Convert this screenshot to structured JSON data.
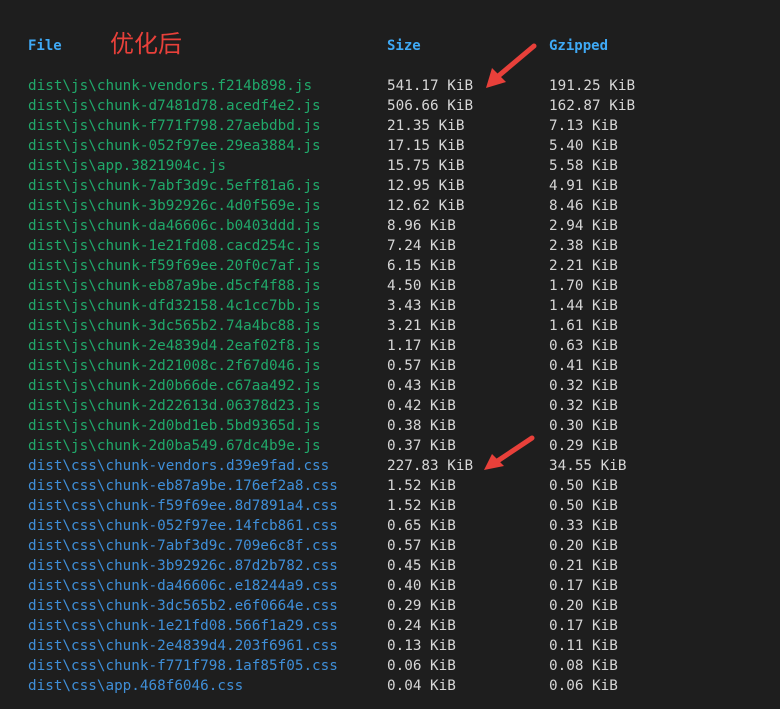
{
  "header": {
    "file": "File",
    "size": "Size",
    "gzipped": "Gzipped"
  },
  "annotation": "优化后",
  "colors": {
    "background": "#1e1e1e",
    "js": "#20a86a",
    "css": "#3f8fd8",
    "header": "#3fa9f5",
    "annotation": "#e8403a",
    "value": "#d6d6d6"
  },
  "rows": [
    {
      "file": "dist\\js\\chunk-vendors.f214b898.js",
      "size": "541.17 KiB",
      "gzip": "191.25 KiB",
      "kind": "js"
    },
    {
      "file": "dist\\js\\chunk-d7481d78.acedf4e2.js",
      "size": "506.66 KiB",
      "gzip": "162.87 KiB",
      "kind": "js"
    },
    {
      "file": "dist\\js\\chunk-f771f798.27aebdbd.js",
      "size": "21.35 KiB",
      "gzip": "7.13 KiB",
      "kind": "js"
    },
    {
      "file": "dist\\js\\chunk-052f97ee.29ea3884.js",
      "size": "17.15 KiB",
      "gzip": "5.40 KiB",
      "kind": "js"
    },
    {
      "file": "dist\\js\\app.3821904c.js",
      "size": "15.75 KiB",
      "gzip": "5.58 KiB",
      "kind": "js"
    },
    {
      "file": "dist\\js\\chunk-7abf3d9c.5eff81a6.js",
      "size": "12.95 KiB",
      "gzip": "4.91 KiB",
      "kind": "js"
    },
    {
      "file": "dist\\js\\chunk-3b92926c.4d0f569e.js",
      "size": "12.62 KiB",
      "gzip": "8.46 KiB",
      "kind": "js"
    },
    {
      "file": "dist\\js\\chunk-da46606c.b0403ddd.js",
      "size": "8.96 KiB",
      "gzip": "2.94 KiB",
      "kind": "js"
    },
    {
      "file": "dist\\js\\chunk-1e21fd08.cacd254c.js",
      "size": "7.24 KiB",
      "gzip": "2.38 KiB",
      "kind": "js"
    },
    {
      "file": "dist\\js\\chunk-f59f69ee.20f0c7af.js",
      "size": "6.15 KiB",
      "gzip": "2.21 KiB",
      "kind": "js"
    },
    {
      "file": "dist\\js\\chunk-eb87a9be.d5cf4f88.js",
      "size": "4.50 KiB",
      "gzip": "1.70 KiB",
      "kind": "js"
    },
    {
      "file": "dist\\js\\chunk-dfd32158.4c1cc7bb.js",
      "size": "3.43 KiB",
      "gzip": "1.44 KiB",
      "kind": "js"
    },
    {
      "file": "dist\\js\\chunk-3dc565b2.74a4bc88.js",
      "size": "3.21 KiB",
      "gzip": "1.61 KiB",
      "kind": "js"
    },
    {
      "file": "dist\\js\\chunk-2e4839d4.2eaf02f8.js",
      "size": "1.17 KiB",
      "gzip": "0.63 KiB",
      "kind": "js"
    },
    {
      "file": "dist\\js\\chunk-2d21008c.2f67d046.js",
      "size": "0.57 KiB",
      "gzip": "0.41 KiB",
      "kind": "js"
    },
    {
      "file": "dist\\js\\chunk-2d0b66de.c67aa492.js",
      "size": "0.43 KiB",
      "gzip": "0.32 KiB",
      "kind": "js"
    },
    {
      "file": "dist\\js\\chunk-2d22613d.06378d23.js",
      "size": "0.42 KiB",
      "gzip": "0.32 KiB",
      "kind": "js"
    },
    {
      "file": "dist\\js\\chunk-2d0bd1eb.5bd9365d.js",
      "size": "0.38 KiB",
      "gzip": "0.30 KiB",
      "kind": "js"
    },
    {
      "file": "dist\\js\\chunk-2d0ba549.67dc4b9e.js",
      "size": "0.37 KiB",
      "gzip": "0.29 KiB",
      "kind": "js"
    },
    {
      "file": "dist\\css\\chunk-vendors.d39e9fad.css",
      "size": "227.83 KiB",
      "gzip": "34.55 KiB",
      "kind": "css"
    },
    {
      "file": "dist\\css\\chunk-eb87a9be.176ef2a8.css",
      "size": "1.52 KiB",
      "gzip": "0.50 KiB",
      "kind": "css"
    },
    {
      "file": "dist\\css\\chunk-f59f69ee.8d7891a4.css",
      "size": "1.52 KiB",
      "gzip": "0.50 KiB",
      "kind": "css"
    },
    {
      "file": "dist\\css\\chunk-052f97ee.14fcb861.css",
      "size": "0.65 KiB",
      "gzip": "0.33 KiB",
      "kind": "css"
    },
    {
      "file": "dist\\css\\chunk-7abf3d9c.709e6c8f.css",
      "size": "0.57 KiB",
      "gzip": "0.20 KiB",
      "kind": "css"
    },
    {
      "file": "dist\\css\\chunk-3b92926c.87d2b782.css",
      "size": "0.45 KiB",
      "gzip": "0.21 KiB",
      "kind": "css"
    },
    {
      "file": "dist\\css\\chunk-da46606c.e18244a9.css",
      "size": "0.40 KiB",
      "gzip": "0.17 KiB",
      "kind": "css"
    },
    {
      "file": "dist\\css\\chunk-3dc565b2.e6f0664e.css",
      "size": "0.29 KiB",
      "gzip": "0.20 KiB",
      "kind": "css"
    },
    {
      "file": "dist\\css\\chunk-1e21fd08.566f1a29.css",
      "size": "0.24 KiB",
      "gzip": "0.17 KiB",
      "kind": "css"
    },
    {
      "file": "dist\\css\\chunk-2e4839d4.203f6961.css",
      "size": "0.13 KiB",
      "gzip": "0.11 KiB",
      "kind": "css"
    },
    {
      "file": "dist\\css\\chunk-f771f798.1af85f05.css",
      "size": "0.06 KiB",
      "gzip": "0.08 KiB",
      "kind": "css"
    },
    {
      "file": "dist\\css\\app.468f6046.css",
      "size": "0.04 KiB",
      "gzip": "0.06 KiB",
      "kind": "css"
    }
  ]
}
